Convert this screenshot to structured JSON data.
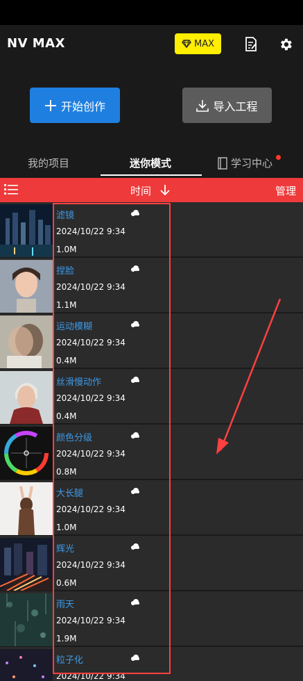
{
  "header": {
    "app_title": "NV MAX",
    "max_badge": "MAX"
  },
  "actions": {
    "create_label": "开始创作",
    "import_label": "导入工程"
  },
  "tabs": [
    {
      "label": "我的项目"
    },
    {
      "label": "迷你模式"
    },
    {
      "label": "学习中心"
    }
  ],
  "toolbar": {
    "sort_label": "时间",
    "manage_label": "管理"
  },
  "projects": [
    {
      "title": "滤镜",
      "date": "2024/10/22 9:34",
      "size": "1.0M"
    },
    {
      "title": "捏脸",
      "date": "2024/10/22 9:34",
      "size": "1.1M"
    },
    {
      "title": "运动模糊",
      "date": "2024/10/22 9:34",
      "size": "0.4M"
    },
    {
      "title": "丝滑慢动作",
      "date": "2024/10/22 9:34",
      "size": "0.4M"
    },
    {
      "title": "颜色分级",
      "date": "2024/10/22 9:34",
      "size": "0.8M"
    },
    {
      "title": "大长腿",
      "date": "2024/10/22 9:34",
      "size": "1.0M"
    },
    {
      "title": "辉光",
      "date": "2024/10/22 9:34",
      "size": "0.6M"
    },
    {
      "title": "雨天",
      "date": "2024/10/22 9:34",
      "size": "1.9M"
    },
    {
      "title": "粒子化",
      "date": "2024/10/22 9:34",
      "size": ""
    }
  ],
  "colors": {
    "accent_red": "#ee3a3a",
    "create_blue": "#1e7fe0",
    "title_blue": "#3d9ae8",
    "badge_yellow": "#ffee00"
  }
}
